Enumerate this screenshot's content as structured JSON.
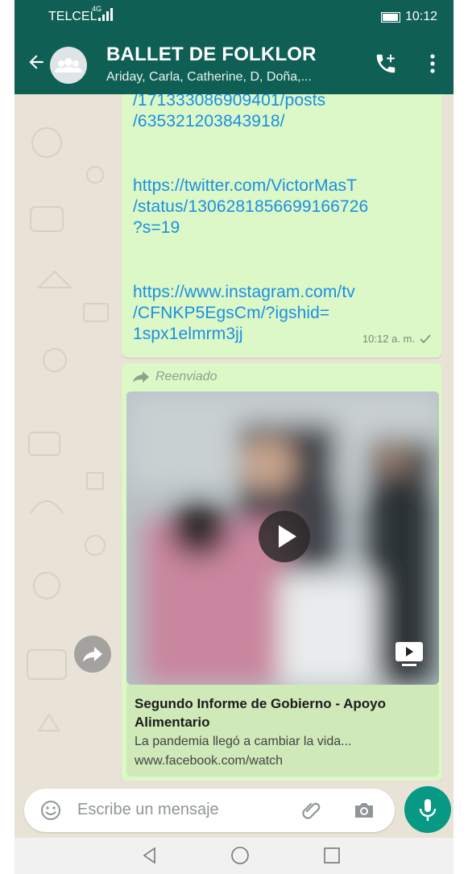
{
  "status_bar": {
    "carrier": "TELCEL",
    "network": "4G",
    "time": "10:12"
  },
  "header": {
    "title": "BALLET DE FOLKLOR",
    "members": "Ariday, Carla, Catherine, D, Doña,..."
  },
  "messages": [
    {
      "links": [
        "/171333086909401/posts",
        "/635321203843918/",
        "",
        "",
        "https://twitter.com/VictorMasT",
        "/status/1306281856699166726",
        "?s=19",
        "",
        "",
        "https://www.instagram.com/tv",
        "/CFNKP5EgsCm/?igshid=",
        "1spx1elmrm3jj"
      ],
      "time": "10:12 a. m."
    },
    {
      "forwarded_label": "Reenviado",
      "preview": {
        "title": "Segundo Informe de Gobierno - Apoyo Alimentario",
        "description": "La pandemia llegó a cambiar la vida...",
        "url": "www.facebook.com/watch"
      }
    }
  ],
  "input": {
    "placeholder": "Escribe un mensaje"
  },
  "icons": {
    "back": "arrow-left-icon",
    "call": "add-call-icon",
    "menu": "more-vert-icon",
    "emoji": "emoji-icon",
    "attach": "paperclip-icon",
    "camera": "camera-icon",
    "mic": "mic-icon",
    "play": "play-icon",
    "share": "share-icon"
  },
  "colors": {
    "header": "#0f5f54",
    "bubble": "#dcf8c6",
    "link": "#1a8fe3",
    "accent": "#079984"
  }
}
